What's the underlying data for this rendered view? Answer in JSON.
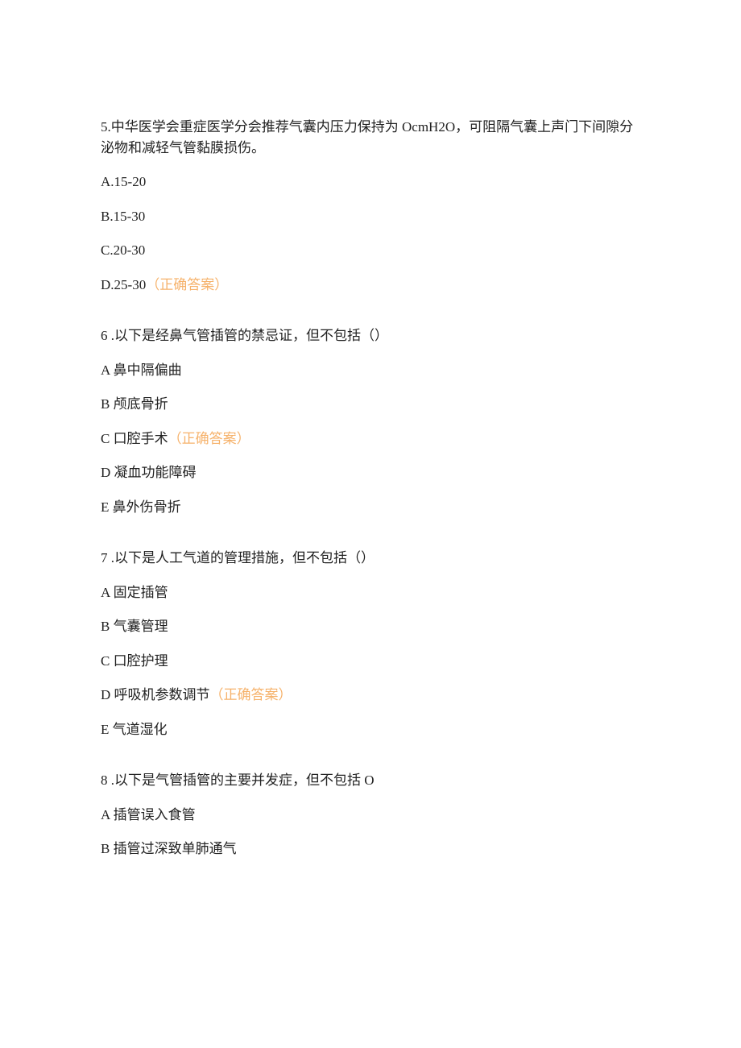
{
  "questions": [
    {
      "number": "5.",
      "stem": "中华医学会重症医学分会推荐气囊内压力保持为 OcmH2O，可阻隔气囊上声门下间隙分泌物和减轻气管黏膜损伤。",
      "options": [
        {
          "label": "A.15-20",
          "correct": false
        },
        {
          "label": "B.15-30",
          "correct": false
        },
        {
          "label": "C.20-30",
          "correct": false
        },
        {
          "label": "D.25-30",
          "correct": true
        }
      ]
    },
    {
      "number": "6 .",
      "stem": "以下是经鼻气管插管的禁忌证，但不包括（）",
      "options": [
        {
          "label": "A 鼻中隔偏曲",
          "correct": false
        },
        {
          "label": "B 颅底骨折",
          "correct": false
        },
        {
          "label": "C 口腔手术",
          "correct": true
        },
        {
          "label": "D 凝血功能障碍",
          "correct": false
        },
        {
          "label": "E 鼻外伤骨折",
          "correct": false
        }
      ]
    },
    {
      "number": "7 .",
      "stem": "以下是人工气道的管理措施，但不包括（）",
      "options": [
        {
          "label": "A 固定插管",
          "correct": false
        },
        {
          "label": "B 气囊管理",
          "correct": false
        },
        {
          "label": "C 口腔护理",
          "correct": false
        },
        {
          "label": "D 呼吸机参数调节",
          "correct": true
        },
        {
          "label": "E 气道湿化",
          "correct": false
        }
      ]
    },
    {
      "number": "8 .",
      "stem": "以下是气管插管的主要并发症，但不包括 O",
      "options": [
        {
          "label": "A 插管误入食管",
          "correct": false
        },
        {
          "label": "B 插管过深致单肺通气",
          "correct": false
        }
      ]
    }
  ],
  "correct_answer_marker": "（正确答案）"
}
